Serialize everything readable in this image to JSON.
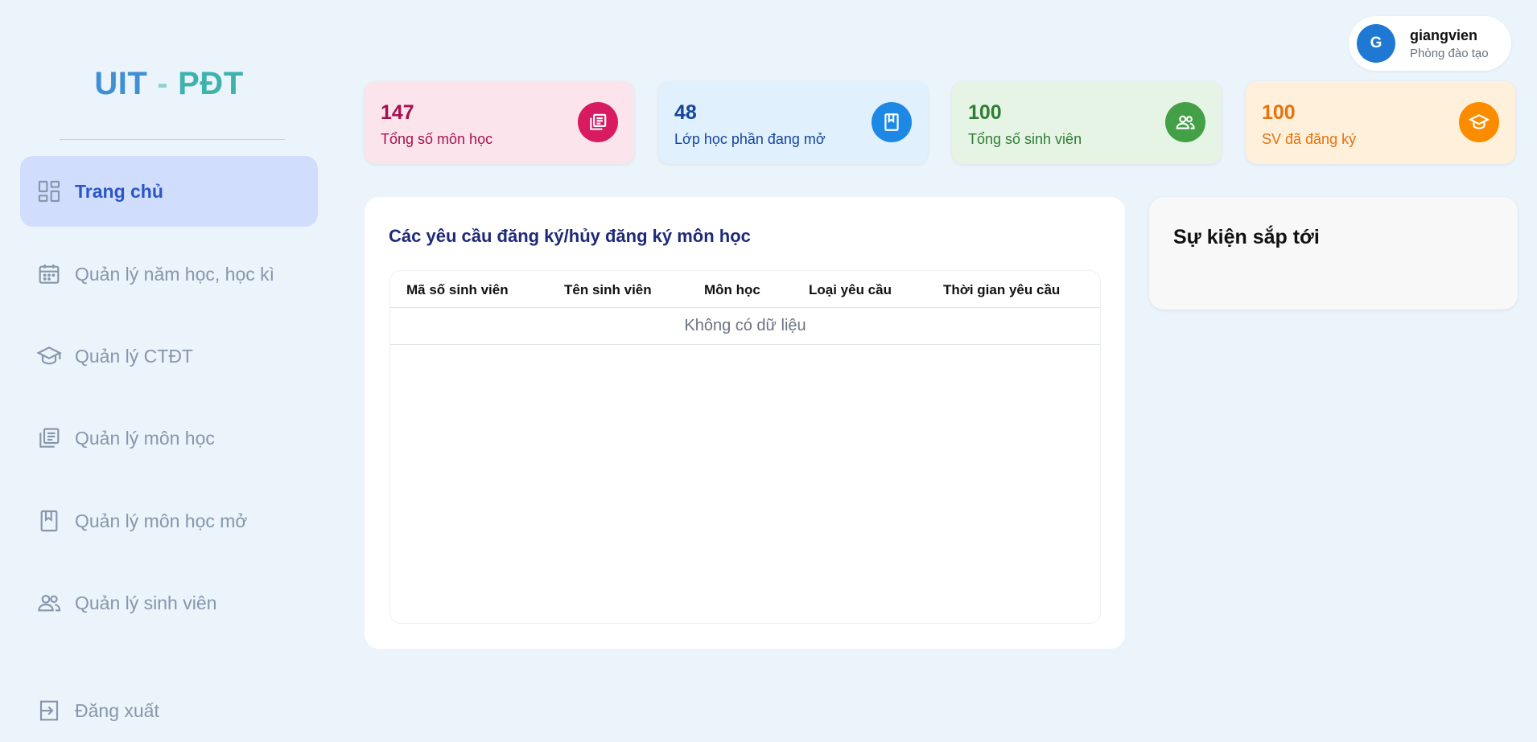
{
  "logo": {
    "part1": "UIT",
    "separator": "-",
    "part2": "PĐT"
  },
  "colors": {
    "background": "#ebf3fb",
    "active_nav_bg": "#d1ddfd",
    "active_nav_text": "#2a56c6",
    "avatar": "#1f78d1"
  },
  "sidebar": {
    "items": [
      {
        "label": "Trang chủ",
        "icon": "dashboard-icon",
        "active": true
      },
      {
        "label": "Quản lý năm học, học kì",
        "icon": "calendar-icon",
        "active": false
      },
      {
        "label": "Quản lý CTĐT",
        "icon": "graduation-cap-icon",
        "active": false
      },
      {
        "label": "Quản lý môn học",
        "icon": "library-books-icon",
        "active": false
      },
      {
        "label": "Quản lý môn học mở",
        "icon": "bookmark-book-icon",
        "active": false
      },
      {
        "label": "Quản lý sinh viên",
        "icon": "people-icon",
        "active": false
      }
    ],
    "logout": {
      "label": "Đăng xuất",
      "icon": "logout-icon"
    }
  },
  "user": {
    "initial": "G",
    "name": "giangvien",
    "role": "Phòng đào tạo"
  },
  "stats": [
    {
      "value": "147",
      "label": "Tổng số môn học",
      "icon": "library-books-icon",
      "bg": "#fbe4ec",
      "fg": "#a3124f",
      "icon_bg": "#d81b60"
    },
    {
      "value": "48",
      "label": "Lớp học phần đang mở",
      "icon": "bookmark-book-icon",
      "bg": "#e1f0fd",
      "fg": "#15459a",
      "icon_bg": "#1e88e5"
    },
    {
      "value": "100",
      "label": "Tổng số sinh viên",
      "icon": "people-icon",
      "bg": "#e6f4e6",
      "fg": "#2f7d32",
      "icon_bg": "#43a047"
    },
    {
      "value": "100",
      "label": "SV đã đăng ký",
      "icon": "graduation-cap-icon",
      "bg": "#fff0dc",
      "fg": "#e8720c",
      "icon_bg": "#fb8c00"
    }
  ],
  "requests": {
    "title": "Các yêu cầu đăng ký/hủy đăng ký môn học",
    "columns": [
      "Mã số sinh viên",
      "Tên sinh viên",
      "Môn học",
      "Loại yêu cầu",
      "Thời gian yêu cầu"
    ],
    "empty_text": "Không có dữ liệu"
  },
  "events": {
    "title": "Sự kiện sắp tới"
  }
}
